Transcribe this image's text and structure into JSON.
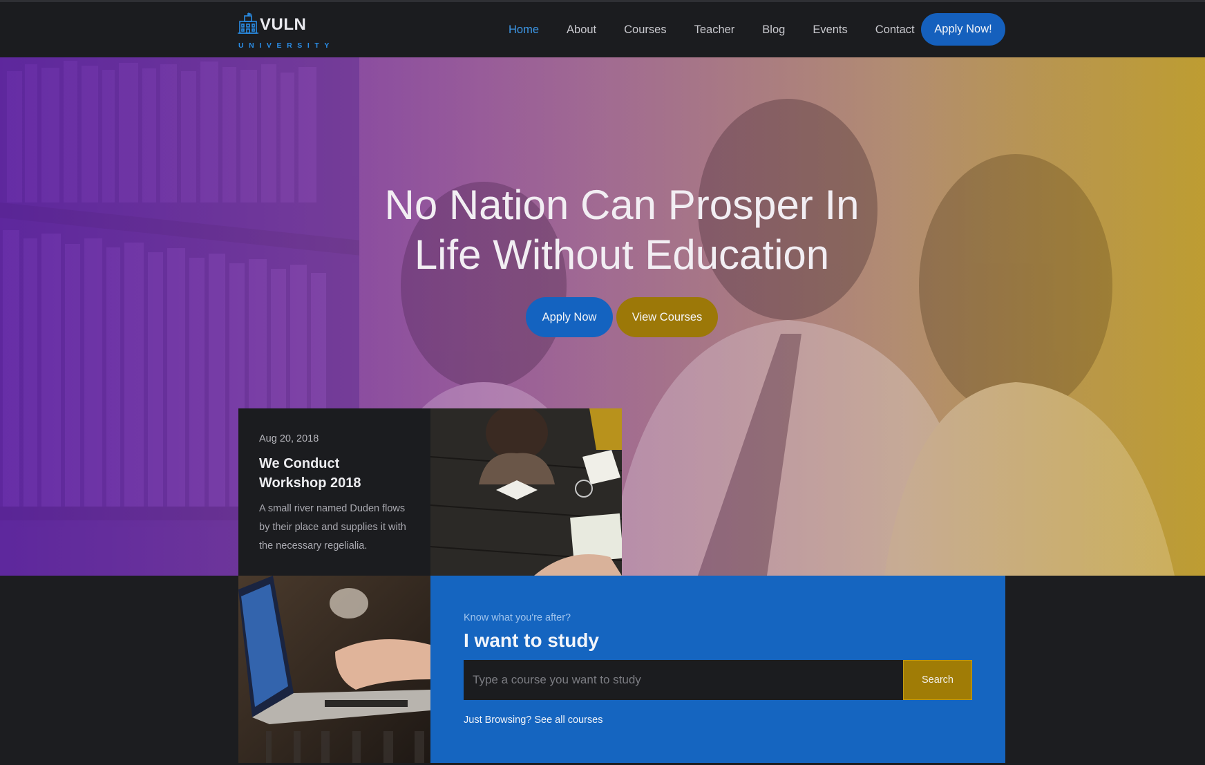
{
  "brand": {
    "name": "VULN",
    "subtitle": "UNIVERSITY"
  },
  "nav": {
    "items": [
      {
        "label": "Home",
        "active": true
      },
      {
        "label": "About"
      },
      {
        "label": "Courses"
      },
      {
        "label": "Teacher"
      },
      {
        "label": "Blog"
      },
      {
        "label": "Events"
      },
      {
        "label": "Contact"
      }
    ],
    "apply_label": "Apply Now!"
  },
  "hero": {
    "title_line1": "No Nation Can Prosper In",
    "title_line2": "Life Without Education",
    "apply_label": "Apply Now",
    "courses_label": "View Courses"
  },
  "event": {
    "date": "Aug 20, 2018",
    "title": "We Conduct Workshop 2018",
    "description": "A small river named Duden flows by their place and supplies it with the necessary regelialia."
  },
  "study": {
    "kicker": "Know what you're after?",
    "heading": "I want to study",
    "placeholder": "Type a course you want to study",
    "search_label": "Search",
    "browse_label": "Just Browsing? See all courses"
  },
  "colors": {
    "accent_blue": "#1565c0",
    "accent_gold": "#a07c06",
    "dark_bg": "#1b1c1f"
  }
}
